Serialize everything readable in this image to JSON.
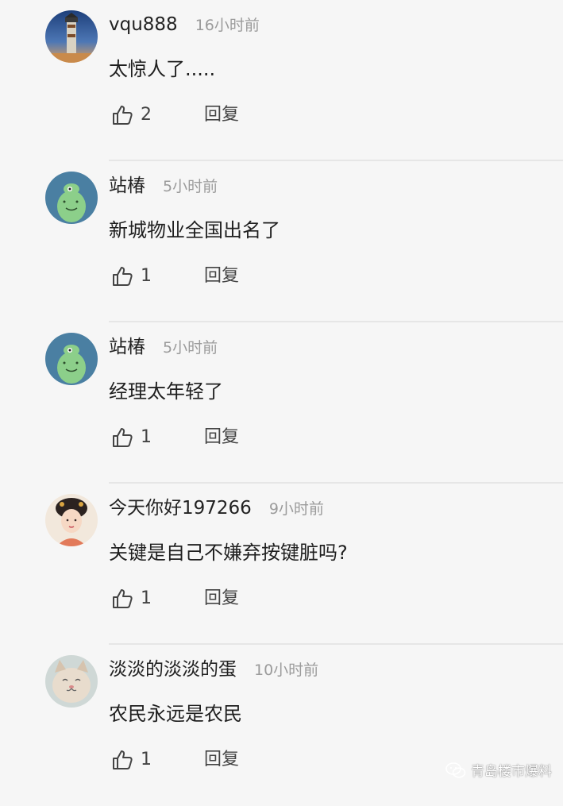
{
  "comments": [
    {
      "username": "vqu888",
      "time": "16小时前",
      "content": "太惊人了.....",
      "likes": "2",
      "reply_label": "回复",
      "avatar": "lighthouse-avatar"
    },
    {
      "username": "站椿",
      "time": "5小时前",
      "content": "新城物业全国出名了",
      "likes": "1",
      "reply_label": "回复",
      "avatar": "green-cartoon-avatar"
    },
    {
      "username": "站椿",
      "time": "5小时前",
      "content": "经理太年轻了",
      "likes": "1",
      "reply_label": "回复",
      "avatar": "green-cartoon-avatar"
    },
    {
      "username": "今天你好197266",
      "time": "9小时前",
      "content": "关键是自己不嫌弃按键脏吗?",
      "likes": "1",
      "reply_label": "回复",
      "avatar": "ancient-lady-avatar"
    },
    {
      "username": "淡淡的淡淡的蛋",
      "time": "10小时前",
      "content": "农民永远是农民",
      "likes": "1",
      "reply_label": "回复",
      "avatar": "cat-avatar"
    }
  ],
  "watermark": {
    "text": "青岛楼市爆料",
    "icon": "wechat-icon"
  },
  "colors": {
    "background": "#f6f6f6",
    "time_text": "#9b9b9b",
    "divider": "#e6e6e6"
  }
}
